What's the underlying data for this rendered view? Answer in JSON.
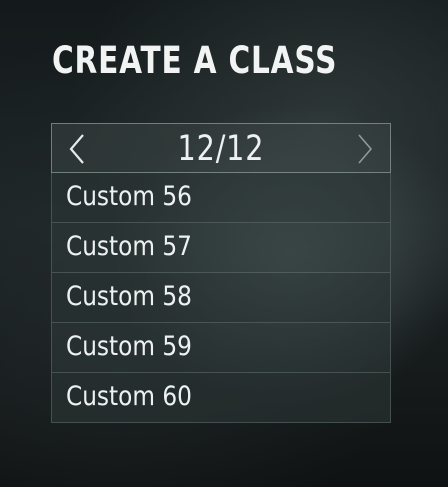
{
  "screen": {
    "title": "CREATE A CLASS"
  },
  "pager": {
    "page": "12/12",
    "prev_icon": "chevron-left-icon",
    "next_icon": "chevron-right-icon"
  },
  "classes": [
    {
      "label": "Custom 56"
    },
    {
      "label": "Custom 57"
    },
    {
      "label": "Custom 58"
    },
    {
      "label": "Custom 59"
    },
    {
      "label": "Custom 60"
    }
  ],
  "colors": {
    "text": "#eef1f1",
    "disabled_arrow": "#9aa6a6"
  }
}
